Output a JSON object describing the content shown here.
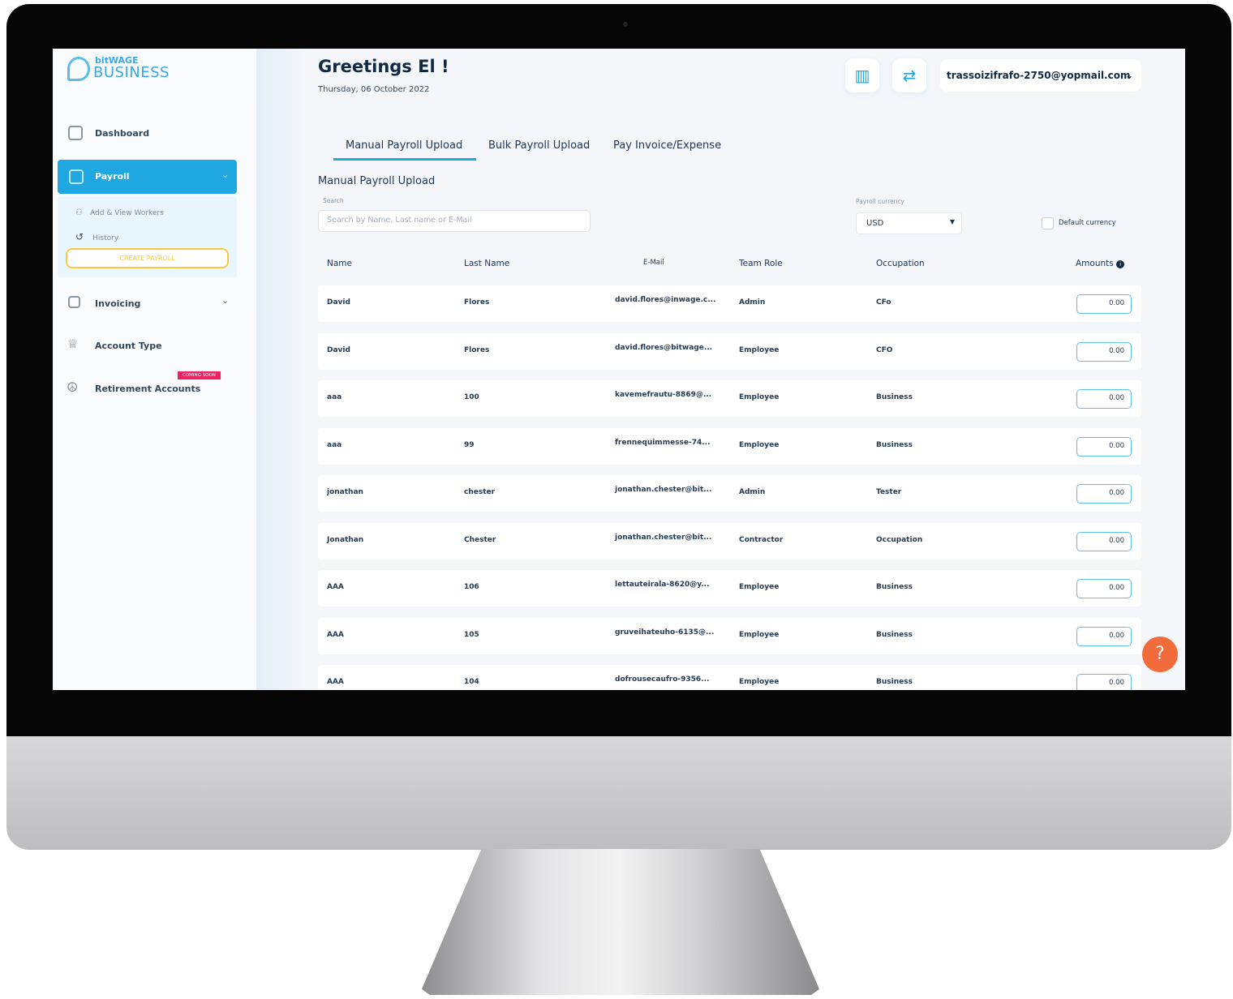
{
  "brand": {
    "line1": "bitWAGE",
    "line2": "BUSINESS"
  },
  "sidebar": {
    "dashboard": "Dashboard",
    "payroll": "Payroll",
    "add_view_workers": "Add & View Workers",
    "history": "History",
    "create_payroll": "CREATE PAYROLL",
    "invoicing": "Invoicing",
    "account_type": "Account Type",
    "retirement": "Retirement Accounts",
    "coming_soon": "COMING SOON"
  },
  "header": {
    "greeting": "Greetings El !",
    "date": "Thursday, 06 October 2022",
    "user_email": "trassoizifrafo-2750@yopmail.com"
  },
  "tabs": [
    {
      "label": "Manual Payroll Upload",
      "active": true
    },
    {
      "label": "Bulk Payroll Upload"
    },
    {
      "label": "Pay Invoice/Expense"
    }
  ],
  "section_title": "Manual Payroll Upload",
  "search": {
    "label": "Search",
    "placeholder": "Search by Name, Last name or E-Mail"
  },
  "currency": {
    "label": "Payroll currency",
    "value": "USD",
    "default_label": "Default currency",
    "default_checked": false
  },
  "table": {
    "headers": [
      "Name",
      "Last Name",
      "E-Mail",
      "Team Role",
      "Occupation",
      "Amounts"
    ],
    "rows": [
      [
        "David",
        "Flores",
        "david.flores@inwage.c...",
        "Admin",
        "CFo",
        "0.00"
      ],
      [
        "David",
        "Flores",
        "david.flores@bitwage...",
        "Employee",
        "CFO",
        "0.00"
      ],
      [
        "aaa",
        "100",
        "kavemefrautu-8869@...",
        "Employee",
        "Business",
        "0.00"
      ],
      [
        "aaa",
        "99",
        "frennequimmesse-74...",
        "Employee",
        "Business",
        "0.00"
      ],
      [
        "jonathan",
        "chester",
        "jonathan.chester@bit...",
        "Admin",
        "Tester",
        "0.00"
      ],
      [
        "Jonathan",
        "Chester",
        "jonathan.chester@bit...",
        "Contractor",
        "Occupation",
        "0.00"
      ],
      [
        "AAA",
        "106",
        "lettauteirala-8620@y...",
        "Employee",
        "Business",
        "0.00"
      ],
      [
        "AAA",
        "105",
        "gruveihateuho-6135@...",
        "Employee",
        "Business",
        "0.00"
      ],
      [
        "AAA",
        "104",
        "dofrousecaufro-9356...",
        "Employee",
        "Business",
        "0.00"
      ]
    ]
  },
  "help": "?",
  "colors": {
    "accent": "#1ea7e0",
    "create_payroll": "#f7c844",
    "coming_soon": "#ef2160",
    "help": "#f26b3a"
  }
}
